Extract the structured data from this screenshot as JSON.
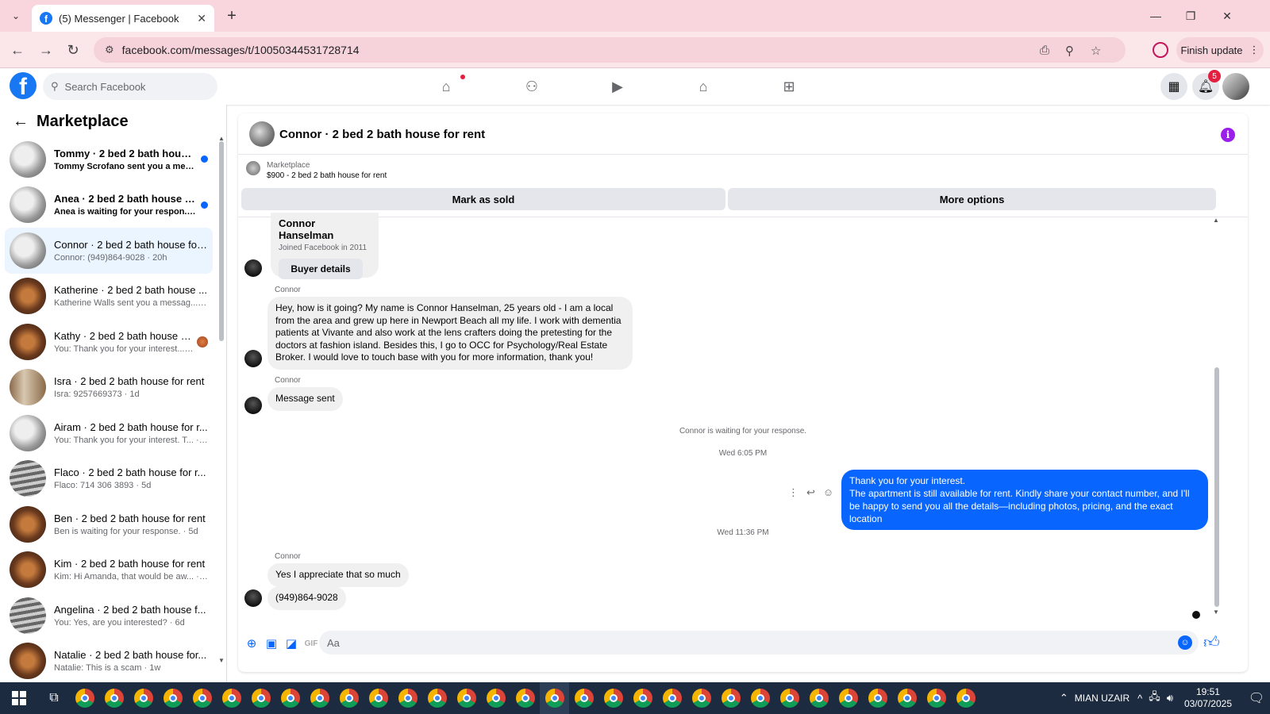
{
  "browser": {
    "tab_title": "(5) Messenger | Facebook",
    "url": "facebook.com/messages/t/10050344531728714",
    "finish_update": "Finish update"
  },
  "fb": {
    "search_placeholder": "Search Facebook",
    "notification_count": "5"
  },
  "sidebar": {
    "title": "Marketplace",
    "conversations": [
      {
        "name": "Tommy · 2 bed 2 bath house f...",
        "snippet": "Tommy Scrofano sent you a me... · 2h",
        "unread": true,
        "avatar": "room"
      },
      {
        "name": "Anea · 2 bed 2 bath house for...",
        "snippet": "Anea is waiting for your respon... · 3h",
        "unread": true,
        "avatar": "room"
      },
      {
        "name": "Connor · 2 bed 2 bath house for...",
        "snippet": "Connor: (949)864-9028 · 20h",
        "unread": false,
        "avatar": "room",
        "active": true
      },
      {
        "name": "Katherine · 2 bed 2 bath house ...",
        "snippet": "Katherine Walls sent you a messag... · 1d",
        "unread": false,
        "avatar": "dark"
      },
      {
        "name": "Kathy · 2 bed 2 bath house fo...",
        "snippet": "You: Thank you for your interest... · 1d",
        "unread": false,
        "avatar": "dark",
        "seen": true
      },
      {
        "name": "Isra · 2 bed 2 bath house for rent",
        "snippet": "Isra: 9257669373 · 1d",
        "unread": false,
        "avatar": "door"
      },
      {
        "name": "Airam · 2 bed 2 bath house for r...",
        "snippet": "You: Thank you for your interest. T... · 3d",
        "unread": false,
        "avatar": "room"
      },
      {
        "name": "Flaco · 2 bed 2 bath house for r...",
        "snippet": "Flaco: 714 306 3893 · 5d",
        "unread": false,
        "avatar": "stairs"
      },
      {
        "name": "Ben · 2 bed 2 bath house for rent",
        "snippet": "Ben is waiting for your response. · 5d",
        "unread": false,
        "avatar": "dark"
      },
      {
        "name": "Kim · 2 bed 2 bath house for rent",
        "snippet": "Kim: Hi Amanda, that would be aw... · 5d",
        "unread": false,
        "avatar": "dark"
      },
      {
        "name": "Angelina · 2 bed 2 bath house f...",
        "snippet": "You: Yes, are you interested? · 6d",
        "unread": false,
        "avatar": "stairs"
      },
      {
        "name": "Natalie · 2 bed 2 bath house for...",
        "snippet": "Natalie: This is a scam · 1w",
        "unread": false,
        "avatar": "dark"
      }
    ]
  },
  "chat": {
    "title": "Connor · 2 bed 2 bath house for rent",
    "listing_label": "Marketplace",
    "listing_price": "$900 - 2 bed 2 bath house for rent",
    "mark_sold": "Mark as sold",
    "more_options": "More options",
    "buyer_name": "Connor Hanselman",
    "buyer_joined": "Joined Facebook in 2011",
    "buyer_details": "Buyer details",
    "sender_name": "Connor",
    "msg_intro": "Hey, how is it going? My name is Connor Hanselman, 25 years old - I am a local from the area and grew up here in Newport Beach all my life. I work with dementia patients at Vivante and also work at the lens crafters doing the pretesting for the doctors at fashion island. Besides this, I go to OCC for Psychology/Real Estate Broker. I would love to touch base with you for more information, thank you!",
    "msg_sent": "Message sent",
    "waiting": "Connor is waiting for your response.",
    "time1": "Wed 6:05 PM",
    "reply_line1": "Thank you for your interest.",
    "reply_line2": "The apartment is still available for rent. Kindly share your contact number, and I'll be happy to send you all the details—including photos, pricing, and the exact location",
    "time2": "Wed 11:36 PM",
    "msg_appreciate": "Yes I appreciate that so much",
    "msg_phone": "(949)864-9028",
    "composer_placeholder": "Aa"
  },
  "taskbar": {
    "user": "MIAN UZAIR",
    "time": "19:51",
    "date": "03/07/2025"
  },
  "colors": {
    "fb_blue": "#1877f2",
    "messenger_blue": "#0866ff",
    "chrome_tab_bar": "#f9d6de"
  }
}
